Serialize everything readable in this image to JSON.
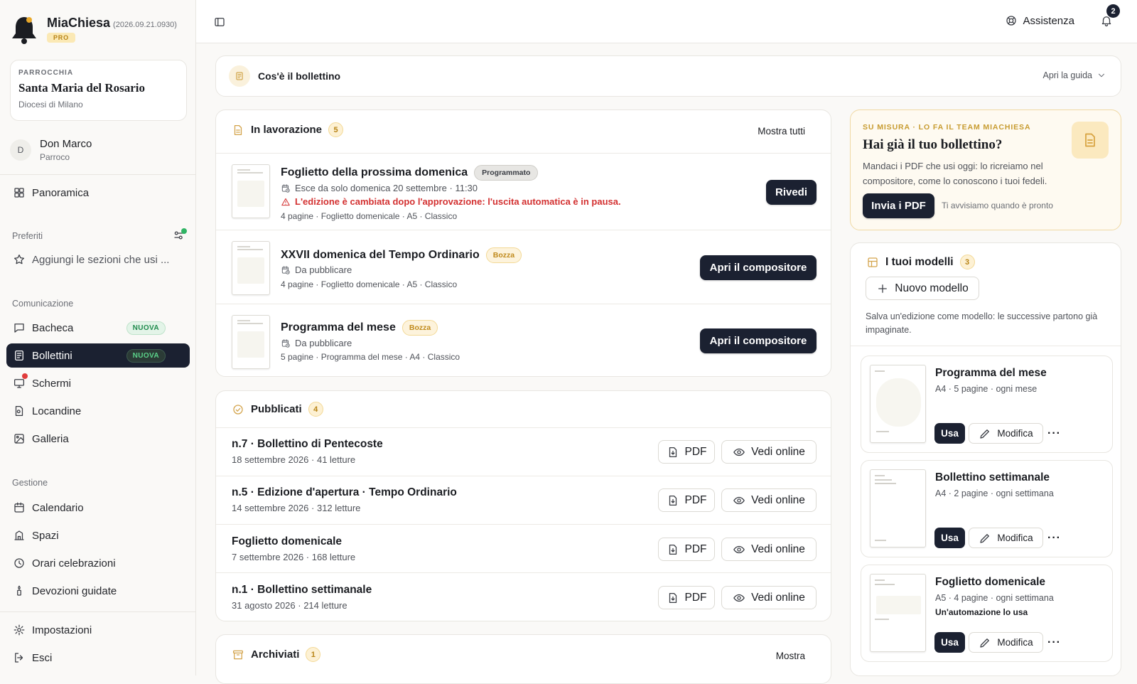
{
  "app": {
    "name": "MiaChiesa",
    "version": "(2026.09.21.0930)",
    "plan": "PRO"
  },
  "parish": {
    "kicker": "PARROCCHIA",
    "name": "Santa Maria del Rosario",
    "diocese": "Diocesi di Milano"
  },
  "user": {
    "initial": "D",
    "name": "Don Marco",
    "role": "Parroco"
  },
  "sidebar": {
    "overview": "Panoramica",
    "favorites_title": "Preferiti",
    "favorites_hint": "Aggiungi le sezioni che usi ...",
    "communication_title": "Comunicazione",
    "communication": [
      {
        "label": "Bacheca",
        "badge": "NUOVA"
      },
      {
        "label": "Bollettini",
        "badge": "NUOVA"
      },
      {
        "label": "Schermi"
      },
      {
        "label": "Locandine"
      },
      {
        "label": "Galleria"
      }
    ],
    "management_title": "Gestione",
    "management": [
      {
        "label": "Calendario"
      },
      {
        "label": "Spazi"
      },
      {
        "label": "Orari celebrazioni"
      },
      {
        "label": "Devozioni guidate"
      }
    ],
    "settings": "Impostazioni",
    "logout": "Esci"
  },
  "topbar": {
    "help": "Assistenza",
    "notifications": "2"
  },
  "guide": {
    "title": "Cos'è il bollettino",
    "action": "Apri la guida"
  },
  "in_progress": {
    "title": "In lavorazione",
    "count": "5",
    "show_all": "Mostra tutti",
    "items": [
      {
        "title": "Foglietto della prossima domenica",
        "status": "Programmato",
        "schedule": "Esce da solo domenica 20 settembre · 11:30",
        "warning": "L'edizione è cambiata dopo l'approvazione: l'uscita automatica è in pausa.",
        "meta": "4 pagine · Foglietto domenicale · A5 · Classico",
        "action": "Rivedi"
      },
      {
        "title": "XXVII domenica del Tempo Ordinario",
        "status": "Bozza",
        "schedule": "Da pubblicare",
        "meta": "4 pagine · Foglietto domenicale · A5 · Classico",
        "action": "Apri il compositore"
      },
      {
        "title": "Programma del mese",
        "status": "Bozza",
        "schedule": "Da pubblicare",
        "meta": "5 pagine · Programma del mese · A4 · Classico",
        "action": "Apri il compositore"
      }
    ]
  },
  "published": {
    "title": "Pubblicati",
    "count": "4",
    "pdf_label": "PDF",
    "view_label": "Vedi online",
    "items": [
      {
        "title": "n.7 · Bollettino di Pentecoste",
        "meta": "18 settembre 2026 · 41 letture"
      },
      {
        "title": "n.5 · Edizione d'apertura · Tempo Ordinario",
        "meta": "14 settembre 2026 · 312 letture"
      },
      {
        "title": "Foglietto domenicale",
        "meta": "7 settembre 2026 · 168 letture"
      },
      {
        "title": "n.1 · Bollettino settimanale",
        "meta": "31 agosto 2026 · 214 letture"
      }
    ]
  },
  "archived": {
    "title": "Archiviati",
    "count": "1",
    "show": "Mostra"
  },
  "promo": {
    "kicker": "SU MISURA · LO FA IL TEAM MIACHIESA",
    "title": "Hai già il tuo bollettino?",
    "description": "Mandaci i PDF che usi oggi: lo ricreiamo nel compositore, come lo conoscono i tuoi fedeli.",
    "action": "Invia i PDF",
    "note": "Ti avvisiamo quando è pronto"
  },
  "models": {
    "title": "I tuoi modelli",
    "count": "3",
    "new_label": "Nuovo modello",
    "description": "Salva un'edizione come modello: le successive partono già impaginate.",
    "use_label": "Usa",
    "edit_label": "Modifica",
    "more_label": "···",
    "items": [
      {
        "title": "Programma del mese",
        "meta": "A4 · 5 pagine · ogni mese"
      },
      {
        "title": "Bollettino settimanale",
        "meta": "A4 · 2 pagine · ogni settimana"
      },
      {
        "title": "Foglietto domenicale",
        "meta": "A5 · 4 pagine · ogni settimana",
        "automation": "Un'automazione lo usa"
      }
    ]
  }
}
